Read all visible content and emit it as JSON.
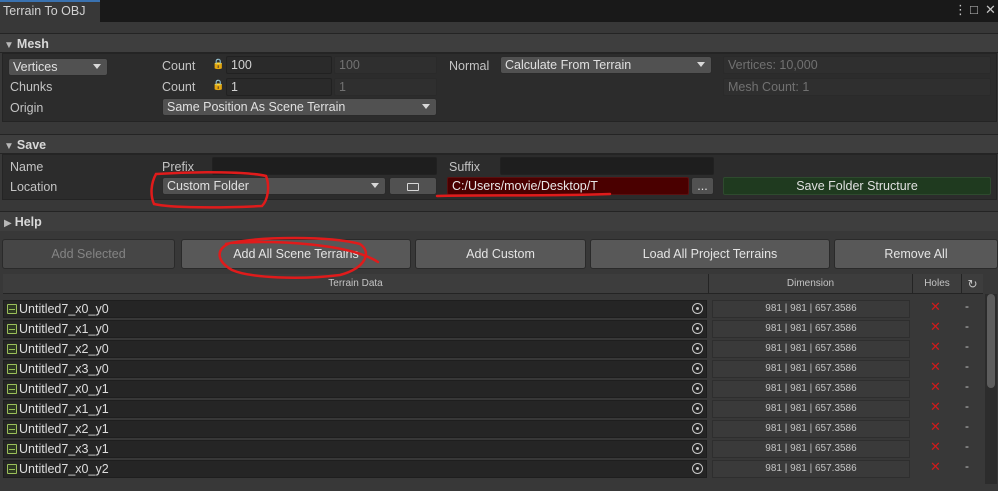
{
  "window": {
    "tab_title": "Terrain To OBJ",
    "menu_icon": "kebab-menu-icon",
    "maximize_icon": "maximize-icon",
    "close_icon": "close-icon"
  },
  "mesh": {
    "header": "Mesh",
    "mode_dropdown": "Vertices",
    "chunks_label": "Chunks",
    "origin_label": "Origin",
    "vertices_count_label": "Count",
    "vertices_count_value": "100",
    "vertices_count_readonly": "100",
    "chunks_count_label": "Count",
    "chunks_count_value": "1",
    "chunks_count_readonly": "1",
    "origin_value": "Same Position As Scene Terrain",
    "normal_label": "Normal",
    "normal_value": "Calculate From Terrain",
    "vertices_info": "Vertices: 10,000",
    "mesh_count_info": "Mesh Count: 1"
  },
  "save": {
    "header": "Save",
    "name_label": "Name",
    "prefix_label": "Prefix",
    "prefix_value": "",
    "suffix_label": "Suffix",
    "suffix_value": "",
    "location_label": "Location",
    "location_value": "Custom Folder",
    "path_value": "C:/Users/movie/Desktop/T",
    "browse_label": "...",
    "save_structure_label": "Save Folder Structure"
  },
  "help": {
    "header": "Help"
  },
  "toolbar": {
    "add_selected": "Add Selected",
    "add_all_scene_terrains": "Add All Scene Terrains",
    "add_custom": "Add Custom",
    "load_all_project_terrains": "Load All Project Terrains",
    "remove_all": "Remove All"
  },
  "table": {
    "headers": {
      "terrain_data": "Terrain Data",
      "dimension": "Dimension",
      "holes": "Holes",
      "refresh_icon": "refresh-icon"
    },
    "rows": [
      {
        "name": "Untitled7_x0_y0",
        "dimension": "981 | 981 | 657.3586",
        "holes": "✕",
        "action": "-"
      },
      {
        "name": "Untitled7_x1_y0",
        "dimension": "981 | 981 | 657.3586",
        "holes": "✕",
        "action": "-"
      },
      {
        "name": "Untitled7_x2_y0",
        "dimension": "981 | 981 | 657.3586",
        "holes": "✕",
        "action": "-"
      },
      {
        "name": "Untitled7_x3_y0",
        "dimension": "981 | 981 | 657.3586",
        "holes": "✕",
        "action": "-"
      },
      {
        "name": "Untitled7_x0_y1",
        "dimension": "981 | 981 | 657.3586",
        "holes": "✕",
        "action": "-"
      },
      {
        "name": "Untitled7_x1_y1",
        "dimension": "981 | 981 | 657.3586",
        "holes": "✕",
        "action": "-"
      },
      {
        "name": "Untitled7_x2_y1",
        "dimension": "981 | 981 | 657.3586",
        "holes": "✕",
        "action": "-"
      },
      {
        "name": "Untitled7_x3_y1",
        "dimension": "981 | 981 | 657.3586",
        "holes": "✕",
        "action": "-"
      },
      {
        "name": "Untitled7_x0_y2",
        "dimension": "981 | 981 | 657.3586",
        "holes": "✕",
        "action": "-"
      }
    ]
  },
  "colors": {
    "accent_tab": "#3a72b0",
    "path_invalid_bg": "#4a0000",
    "save_structure_bg": "#1f3a1f",
    "holes_x": "#d01b1b",
    "annotation": "#e01b1b"
  }
}
